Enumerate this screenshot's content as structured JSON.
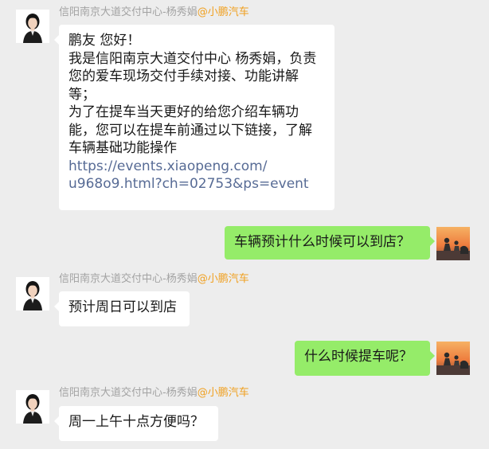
{
  "colors": {
    "background": "#ededed",
    "incoming_bubble": "#ffffff",
    "outgoing_bubble": "#95ec69",
    "sender_name": "#a3a3a3",
    "sender_brand": "#f0a020",
    "link": "#576b95"
  },
  "messages": [
    {
      "direction": "incoming",
      "sender_name": "信阳南京大道交付中心-杨秀娟",
      "sender_brand": "@小鹏汽车",
      "avatar": "agent-avatar",
      "lines": [
        "鹏友 您好！",
        "我是信阳南京大道交付中心 杨秀娟，负责",
        "您的爱车现场交付手续对接、功能讲解",
        "等；",
        "为了在提车当天更好的给您介绍车辆功",
        "能，您可以在提车前通过以下链接，了解",
        "车辆基础功能操作"
      ],
      "link_lines": [
        "https://events.xiaopeng.com/",
        "u968o9.html?ch=02753&ps=event"
      ]
    },
    {
      "direction": "outgoing",
      "avatar": "user-avatar",
      "text": "车辆预计什么时候可以到店？"
    },
    {
      "direction": "incoming",
      "sender_name": "信阳南京大道交付中心-杨秀娟",
      "sender_brand": "@小鹏汽车",
      "avatar": "agent-avatar",
      "text": "预计周日可以到店"
    },
    {
      "direction": "outgoing",
      "avatar": "user-avatar",
      "text": "什么时候提车呢？"
    },
    {
      "direction": "incoming",
      "sender_name": "信阳南京大道交付中心-杨秀娟",
      "sender_brand": "@小鹏汽车",
      "avatar": "agent-avatar",
      "text": "周一上午十点方便吗？"
    }
  ]
}
